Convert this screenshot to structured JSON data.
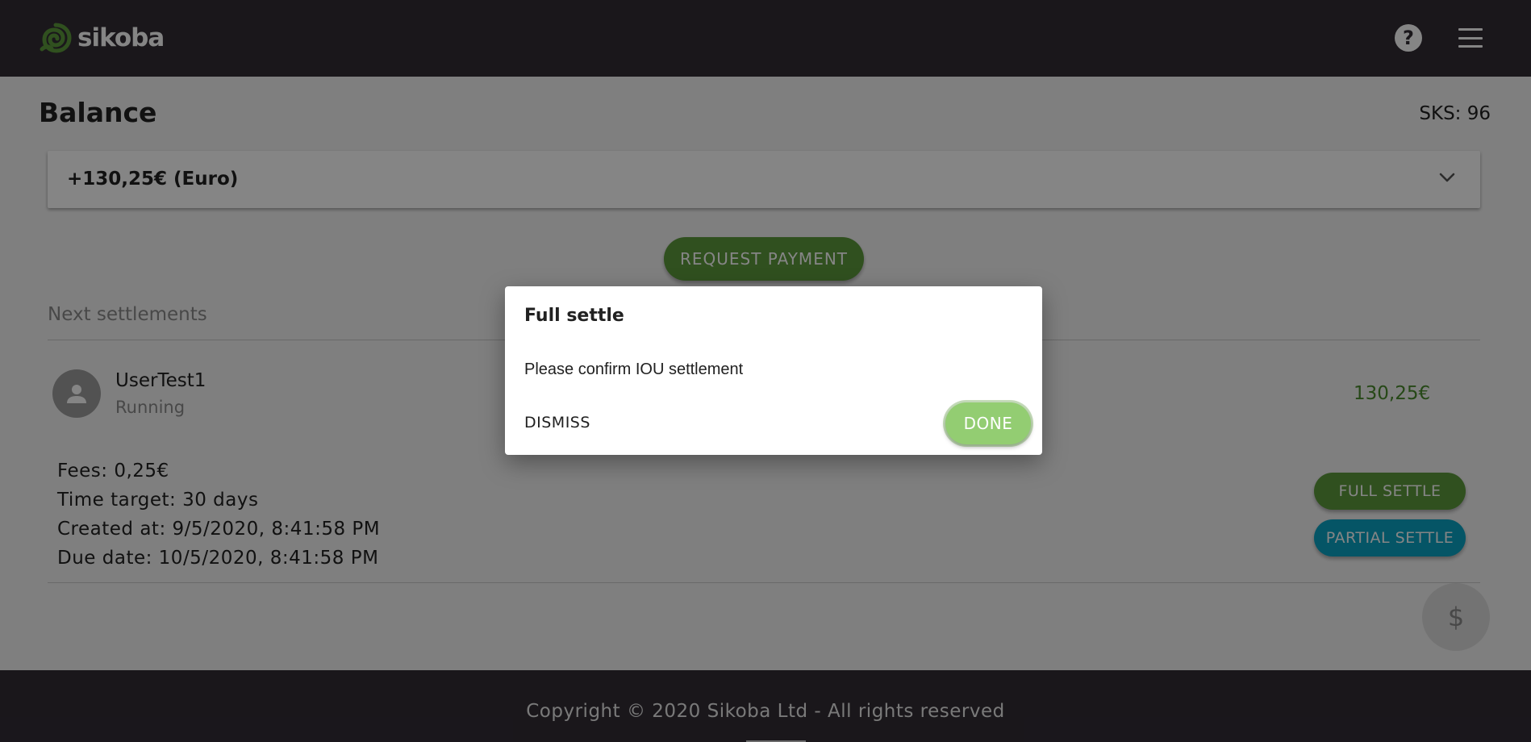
{
  "header": {
    "logo_text": "sikoba",
    "logo_icon": "spiral-logo-icon",
    "help_icon": "help-icon",
    "menu_icon": "menu-icon",
    "help_glyph": "?"
  },
  "page": {
    "title": "Balance",
    "sks_label": "SKS: 96"
  },
  "balance": {
    "amount_label": "+130,25€ (Euro)",
    "expand_icon": "chevron-down-icon"
  },
  "actions": {
    "request_payment": "REQUEST PAYMENT"
  },
  "settlements": {
    "section_title": "Next settlements",
    "items": [
      {
        "user": "UserTest1",
        "status": "Running",
        "amount": "130,25€",
        "fees": "Fees: 0,25€",
        "time_target": "Time target: 30 days",
        "created_at": "Created at: 9/5/2020, 8:41:58 PM",
        "due_date": "Due date: 10/5/2020, 8:41:58 PM",
        "full_settle": "FULL SETTLE",
        "partial_settle": "PARTIAL SETTLE"
      }
    ]
  },
  "fab": {
    "icon": "dollar-icon",
    "glyph": "$"
  },
  "footer": {
    "copyright": "Copyright © 2020 Sikoba Ltd - All rights reserved"
  },
  "dialog": {
    "title": "Full settle",
    "message": "Please confirm IOU settlement",
    "dismiss": "DISMISS",
    "done": "DONE"
  },
  "colors": {
    "topbar": "#322d35",
    "brand_green": "#5c9a3c",
    "teal": "#0aa4c4",
    "done_green": "#93cd72"
  }
}
